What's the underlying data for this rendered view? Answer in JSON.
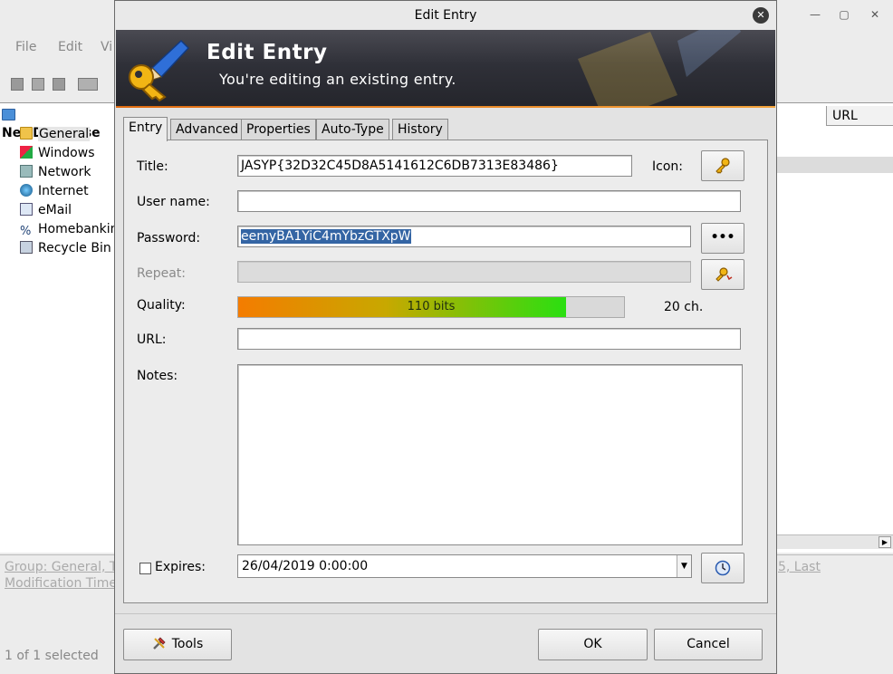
{
  "main": {
    "menu": [
      "File",
      "Edit",
      "Vi"
    ],
    "tree": {
      "root": "NewDatabase",
      "items": [
        "General",
        "Windows",
        "Network",
        "Internet",
        "eMail",
        "Homebankin",
        "Recycle Bin"
      ]
    },
    "list": {
      "url_header": "URL"
    },
    "details": {
      "line1": "Group: General, Ti",
      "line2": "Modification Time:",
      "right_partial": "5, Last"
    },
    "status": "1 of 1 selected"
  },
  "dialog": {
    "title": "Edit Entry",
    "banner_title": "Edit Entry",
    "banner_subtitle": "You're editing an existing entry.",
    "tabs": [
      "Entry",
      "Advanced",
      "Properties",
      "Auto-Type",
      "History"
    ],
    "labels": {
      "title": "Title:",
      "icon": "Icon:",
      "username": "User name:",
      "password": "Password:",
      "repeat": "Repeat:",
      "quality": "Quality:",
      "url": "URL:",
      "notes": "Notes:",
      "expires": "Expires:"
    },
    "values": {
      "title": "JASYP{32D32C45D8A5141612C6DB7313E83486}",
      "username": "",
      "password": "eemyBA1YiC4mYbzGTXpW",
      "repeat": "",
      "url": "",
      "notes": "",
      "expires": "26/04/2019 0:00:00"
    },
    "quality": {
      "text": "110 bits",
      "fraction": 0.85,
      "chars": "20 ch."
    },
    "buttons": {
      "show_password": "•••",
      "tools": "Tools",
      "ok": "OK",
      "cancel": "Cancel"
    },
    "icons": {
      "entry_icon": "key-icon",
      "generate": "password-generator-icon",
      "expiry": "clock-icon",
      "tools": "tools-icon"
    }
  }
}
